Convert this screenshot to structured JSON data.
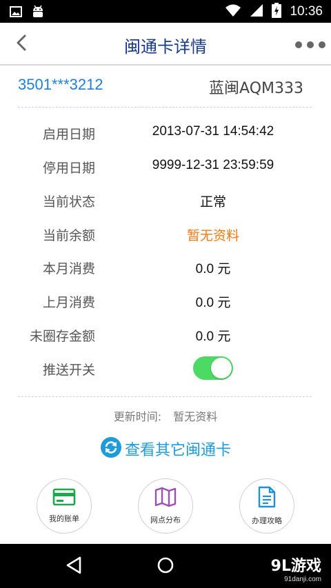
{
  "status_bar": {
    "time": "10:36",
    "icons": [
      "image-icon",
      "android-icon",
      "wifi-icon",
      "signal-icon",
      "battery-charging-icon"
    ]
  },
  "header": {
    "title": "闽通卡详情",
    "back_icon": "chevron-left-icon",
    "more_icon": "more-dots-icon"
  },
  "card": {
    "number": "3501***3212",
    "plate": "蓝闽AQM333"
  },
  "details": [
    {
      "label": "启用日期",
      "value": "2013-07-31 14:54:42"
    },
    {
      "label": "停用日期",
      "value": "9999-12-31 23:59:59"
    },
    {
      "label": "当前状态",
      "value": "正常"
    },
    {
      "label": "当前余额",
      "value": "暂无资料"
    },
    {
      "label": "本月消费",
      "value": "0.0  元"
    },
    {
      "label": "上月消费",
      "value": "0.0  元"
    },
    {
      "label": "未圈存金额",
      "value": "0.0  元"
    },
    {
      "label": "推送开关"
    }
  ],
  "push_toggle": {
    "on": true,
    "color": "#4cd964"
  },
  "update": {
    "label": "更新时间:",
    "value": "暂无资料"
  },
  "other_cards": {
    "label": "查看其它闽通卡",
    "icon": "refresh-icon"
  },
  "menu": [
    {
      "label": "我的账单",
      "icon": "bill-card-icon"
    },
    {
      "label": "网点分布",
      "icon": "map-icon"
    },
    {
      "label": "办理攻略",
      "icon": "document-icon"
    }
  ],
  "nav_bar": {
    "icons": [
      "back-triangle-icon",
      "home-circle-icon"
    ],
    "watermark": "9L游戏",
    "watermark_url": "91danji.com"
  },
  "colors": {
    "accent_blue": "#1f7fd6",
    "title_blue": "#1a3a8a",
    "orange": "#f07a12",
    "green": "#4cd964"
  }
}
